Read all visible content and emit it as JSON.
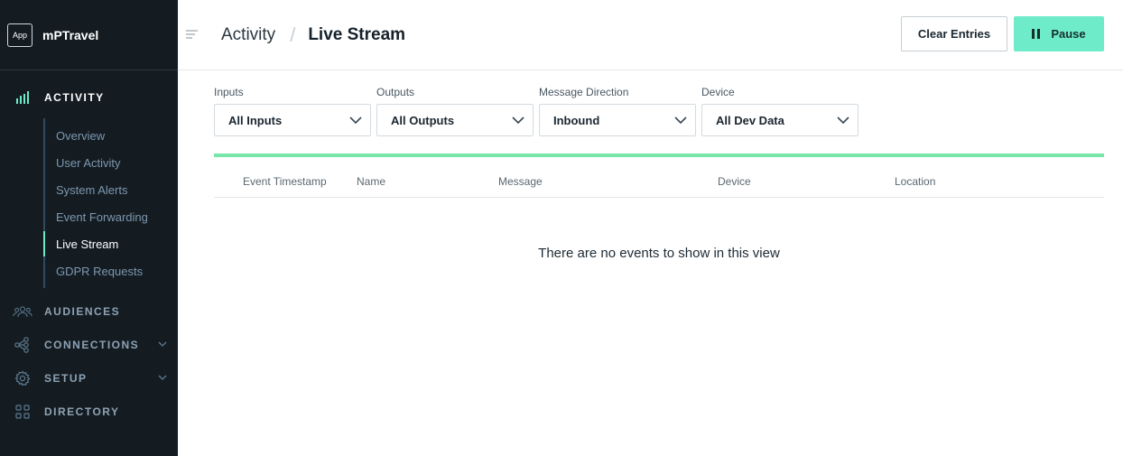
{
  "brand": {
    "logo_text": "App",
    "name": "mPTravel"
  },
  "sidebar": {
    "sections": [
      {
        "label": "ACTIVITY",
        "icon": "bar-chart-icon",
        "active": true
      },
      {
        "label": "AUDIENCES",
        "icon": "users-icon"
      },
      {
        "label": "CONNECTIONS",
        "icon": "connections-icon",
        "expandable": true
      },
      {
        "label": "SETUP",
        "icon": "gear-icon",
        "expandable": true
      },
      {
        "label": "DIRECTORY",
        "icon": "grid-icon"
      }
    ],
    "activity_items": [
      {
        "label": "Overview"
      },
      {
        "label": "User Activity"
      },
      {
        "label": "System Alerts"
      },
      {
        "label": "Event Forwarding"
      },
      {
        "label": "Live Stream",
        "active": true
      },
      {
        "label": "GDPR Requests"
      }
    ]
  },
  "header": {
    "breadcrumb_root": "Activity",
    "breadcrumb_separator": "/",
    "title": "Live Stream",
    "clear_label": "Clear Entries",
    "pause_label": "Pause"
  },
  "filters": [
    {
      "label": "Inputs",
      "value": "All Inputs"
    },
    {
      "label": "Outputs",
      "value": "All Outputs"
    },
    {
      "label": "Message Direction",
      "value": "Inbound"
    },
    {
      "label": "Device",
      "value": "All Dev Data"
    }
  ],
  "stream_progress": 1.0,
  "table": {
    "columns": [
      "Event Timestamp",
      "Name",
      "Message",
      "Device",
      "Location"
    ],
    "empty_message": "There are no events to show in this view"
  },
  "colors": {
    "sidebar_bg": "#141c22",
    "accent": "#6eebc9",
    "progress": "#77e6a9"
  }
}
